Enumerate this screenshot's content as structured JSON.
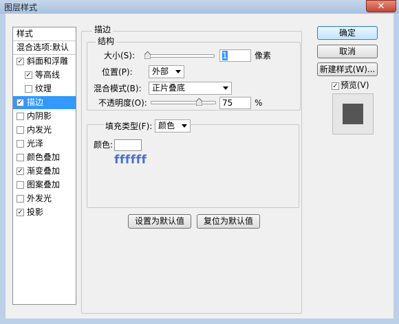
{
  "window": {
    "title": "图层样式",
    "close_glyph": "✕"
  },
  "style_list": {
    "header": "样式",
    "blend_options": "混合选项:默认",
    "items": [
      {
        "label": "斜面和浮雕",
        "checked": true,
        "indent": false
      },
      {
        "label": "等高线",
        "checked": true,
        "indent": true
      },
      {
        "label": "纹理",
        "checked": false,
        "indent": true
      },
      {
        "label": "描边",
        "checked": true,
        "indent": false,
        "selected": true
      },
      {
        "label": "内阴影",
        "checked": false,
        "indent": false
      },
      {
        "label": "内发光",
        "checked": false,
        "indent": false
      },
      {
        "label": "光泽",
        "checked": false,
        "indent": false
      },
      {
        "label": "颜色叠加",
        "checked": false,
        "indent": false
      },
      {
        "label": "渐变叠加",
        "checked": true,
        "indent": false
      },
      {
        "label": "图案叠加",
        "checked": false,
        "indent": false
      },
      {
        "label": "外发光",
        "checked": false,
        "indent": false
      },
      {
        "label": "投影",
        "checked": true,
        "indent": false
      }
    ]
  },
  "stroke": {
    "group_title": "描边",
    "structure_title": "结构",
    "size_label": "大小(S):",
    "size_value": "1",
    "size_unit": "像素",
    "size_level": 0.01,
    "position_label": "位置(P):",
    "position_value": "外部",
    "blend_mode_label": "混合模式(B):",
    "blend_mode_value": "正片叠底",
    "opacity_label": "不透明度(O):",
    "opacity_value": "75",
    "opacity_unit": "%",
    "opacity_level": 0.75
  },
  "fill": {
    "fill_type_label": "填充类型(F):",
    "fill_type_value": "颜色",
    "color_label": "颜色:",
    "color_hex_note": "ffffff",
    "color_value": "#ffffff"
  },
  "bottom_buttons": {
    "set_default": "设置为默认值",
    "reset_default": "复位为默认值"
  },
  "right_panel": {
    "ok": "确定",
    "cancel": "取消",
    "new_style": "新建样式(W)...",
    "preview_label": "预览(V)",
    "preview_checked": true
  },
  "colors": {
    "selection": "#3399ff",
    "accent_note": "#4a6fd0",
    "preview_swatch": "#555555"
  }
}
